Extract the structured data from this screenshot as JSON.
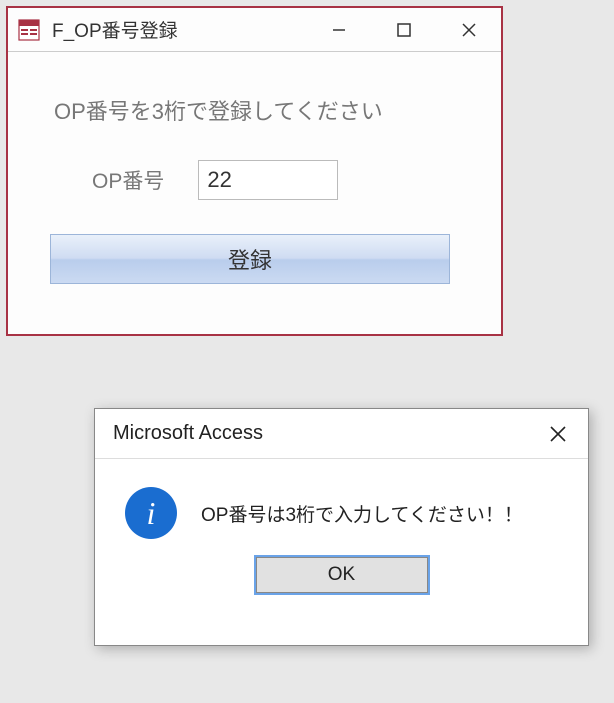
{
  "form": {
    "title": "F_OP番号登録",
    "instruction": "OP番号を3桁で登録してください",
    "field_label": "OP番号",
    "field_value": "22",
    "register_label": "登録"
  },
  "dialog": {
    "title": "Microsoft Access",
    "icon_glyph": "i",
    "message": "OP番号は3桁で入力してください！！",
    "ok_label": "OK"
  }
}
